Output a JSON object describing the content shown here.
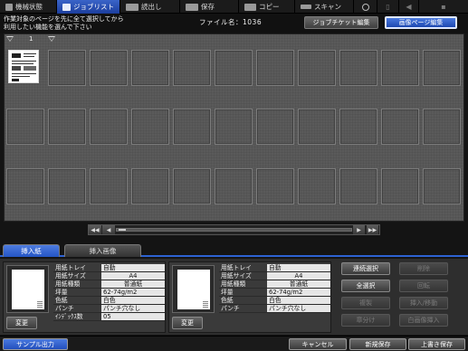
{
  "topbar": {
    "tabs": [
      {
        "label": "機械状態",
        "icon": "machine-status-icon"
      },
      {
        "label": "ジョブリスト",
        "icon": "job-list-icon"
      },
      {
        "label": "読出し",
        "icon": "retrieve-icon"
      },
      {
        "label": "保存",
        "icon": "store-icon"
      },
      {
        "label": "コピー",
        "icon": "copy-icon"
      },
      {
        "label": "スキャン",
        "icon": "scan-icon"
      }
    ]
  },
  "header": {
    "instruction_line1": "作業対象のページを先に全て選択してから",
    "instruction_line2": "利用したい機能を選んで下さい",
    "filename": "ファイル名：1036",
    "job_ticket_button": "ジョブチケット編集",
    "image_page_button": "画像ページ編集"
  },
  "grid": {
    "page_number": "1"
  },
  "colors": {
    "accent": "#2d62d3",
    "grid_bg": "#5a5a5a"
  },
  "tabs": {
    "insert_paper": "挿入紙",
    "insert_image": "挿入画像"
  },
  "panel_left": {
    "change_button": "変更",
    "rows": [
      {
        "key": "用紙トレイ",
        "value": "自動"
      },
      {
        "key": "用紙サイズ",
        "value": "A4"
      },
      {
        "key": "用紙種類",
        "value": "普通紙"
      },
      {
        "key": "坪量",
        "value": "62-74g/m2"
      },
      {
        "key": "色紙",
        "value": "白色"
      },
      {
        "key": "パンチ",
        "value": "パンチ穴なし"
      },
      {
        "key": "ｲﾝﾃﾞｯｸｽ数",
        "value": "05"
      }
    ]
  },
  "panel_right": {
    "change_button": "変更",
    "rows": [
      {
        "key": "用紙トレイ",
        "value": "自動"
      },
      {
        "key": "用紙サイズ",
        "value": "A4"
      },
      {
        "key": "用紙種類",
        "value": "普通紙"
      },
      {
        "key": "坪量",
        "value": "62-74g/m2"
      },
      {
        "key": "色紙",
        "value": "白色"
      },
      {
        "key": "パンチ",
        "value": "パンチ穴なし"
      }
    ]
  },
  "actions": {
    "continuous_select": "連続選択",
    "select_all": "全選択",
    "duplicate": "複製",
    "chapter": "章分け",
    "delete": "削除",
    "rotate": "回転",
    "insert_move": "挿入/移動",
    "blank_insert": "白画像挿入"
  },
  "footer": {
    "sample_output": "サンプル出力",
    "cancel": "キャンセル",
    "new_save": "新規保存",
    "overwrite_save": "上書き保存"
  }
}
